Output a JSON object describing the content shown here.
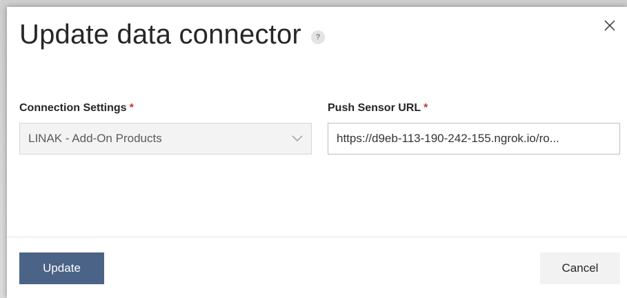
{
  "dialog": {
    "title": "Update data connector",
    "help_glyph": "?",
    "close_glyph": "×"
  },
  "connection_settings": {
    "label": "Connection Settings",
    "required_marker": "*",
    "selected_value": "LINAK - Add-On Products"
  },
  "push_sensor_url": {
    "label": "Push Sensor URL",
    "required_marker": "*",
    "value": "https://d9eb-113-190-242-155.ngrok.io/ro..."
  },
  "footer": {
    "update_label": "Update",
    "cancel_label": "Cancel"
  },
  "colors": {
    "primary_button": "#4a6386",
    "required_marker": "#c0392b"
  },
  "icons": {
    "help": "help-icon",
    "close": "close-icon",
    "dropdown": "chevron-down-icon"
  }
}
